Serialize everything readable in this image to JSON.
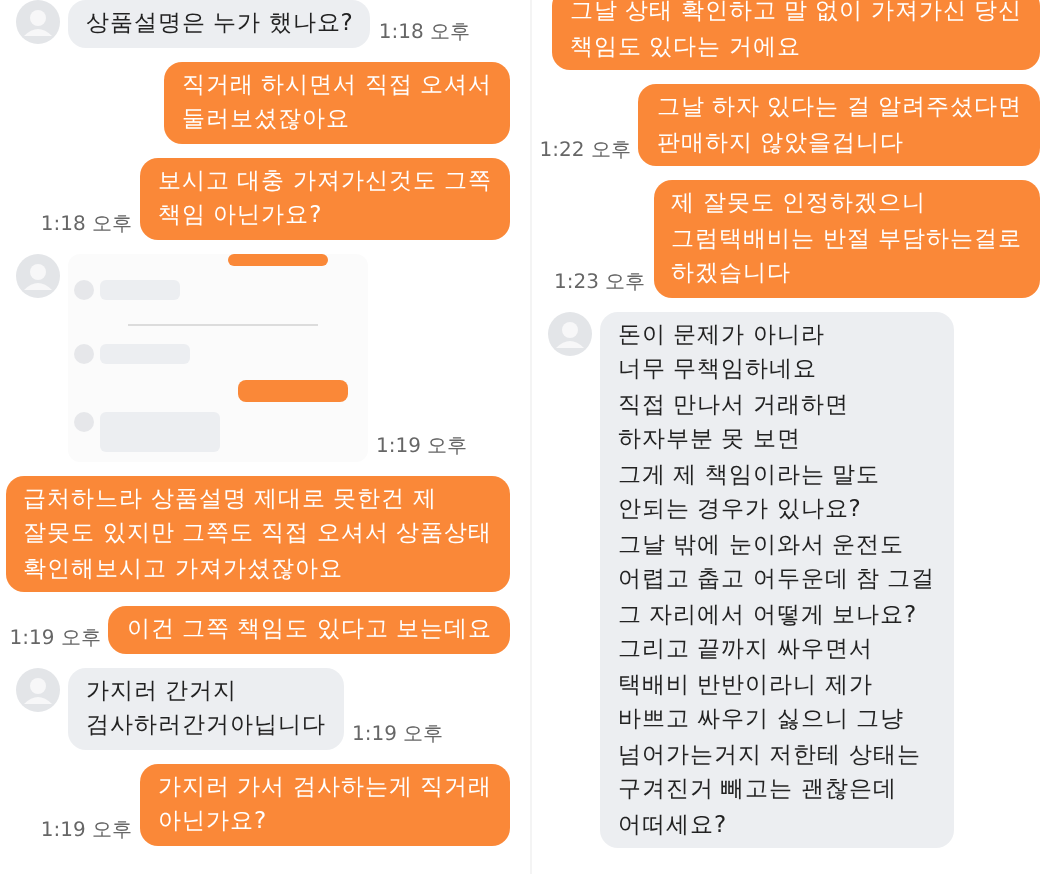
{
  "panels": [
    {
      "messages": [
        {
          "kind": "incoming",
          "text": "상품설명은 누가 했나요?",
          "time": "1:18 오후"
        },
        {
          "kind": "outgoing",
          "text": "직거래 하시면서 직접 오셔서\n둘러보셨잖아요"
        },
        {
          "kind": "outgoing",
          "text": "보시고 대충 가져가신것도 그쪽\n책임 아닌가요?",
          "time": "1:18 오후"
        },
        {
          "kind": "picture",
          "time": "1:19 오후"
        },
        {
          "kind": "outgoing",
          "text": "급처하느라 상품설명 제대로 못한건 제\n잘못도 있지만 그쪽도 직접 오셔서 상품상태\n확인해보시고 가져가셨잖아요"
        },
        {
          "kind": "outgoing",
          "text": "이건 그쪽 책임도 있다고 보는데요",
          "time": "1:19 오후"
        },
        {
          "kind": "incoming",
          "text": "가지러 간거지\n검사하러간거아닙니다",
          "time": "1:19 오후"
        },
        {
          "kind": "outgoing",
          "text": "가지러 가서 검사하는게 직거래\n아닌가요?",
          "time": "1:19 오후"
        }
      ]
    },
    {
      "messages": [
        {
          "kind": "outgoing",
          "text": "그날 상태 확인하고 말 없이 가져가신 당신\n책임도 있다는 거에요"
        },
        {
          "kind": "outgoing",
          "text": "그날 하자 있다는 걸 알려주셨다면\n판매하지 않았을겁니다",
          "time": "1:22 오후"
        },
        {
          "kind": "outgoing",
          "text": "제 잘못도 인정하겠으니\n그럼택배비는 반절 부담하는걸로\n하겠습니다",
          "time": "1:23 오후"
        },
        {
          "kind": "incoming",
          "text": "돈이 문제가 아니라\n너무 무책임하네요\n직접 만나서 거래하면\n하자부분 못 보면\n그게 제 책임이라는 말도\n안되는 경우가 있나요?\n그날 밖에 눈이와서 운전도\n어렵고 춥고 어두운데 참 그걸\n그 자리에서 어떻게 보나요?\n그리고 끝까지 싸우면서\n택배비 반반이라니 제가\n바쁘고 싸우기 싫으니 그냥\n넘어가는거지 저한테 상태는\n구겨진거 빼고는 괜찮은데\n어떠세요?"
        }
      ]
    }
  ]
}
